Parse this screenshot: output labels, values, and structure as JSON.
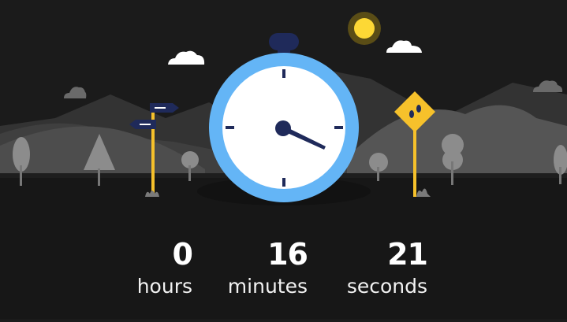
{
  "colors": {
    "background": "#1b1b1b",
    "ground": "#131313",
    "hills_far": "#3a3a3a",
    "hills_mid": "#4a4a4a",
    "hills_near": "#5c5c5c",
    "trees": "#9a9a9a",
    "sun": "#fdd835",
    "stopwatch_ring": "#64b5f6",
    "stopwatch_face": "#ffffff",
    "stopwatch_marks": "#1f2a5a",
    "sign_post": "#f6c12b"
  },
  "timer": {
    "hours_value": "0",
    "hours_label": "hours",
    "minutes_value": "16",
    "minutes_label": "minutes",
    "seconds_value": "21",
    "seconds_label": "seconds"
  }
}
